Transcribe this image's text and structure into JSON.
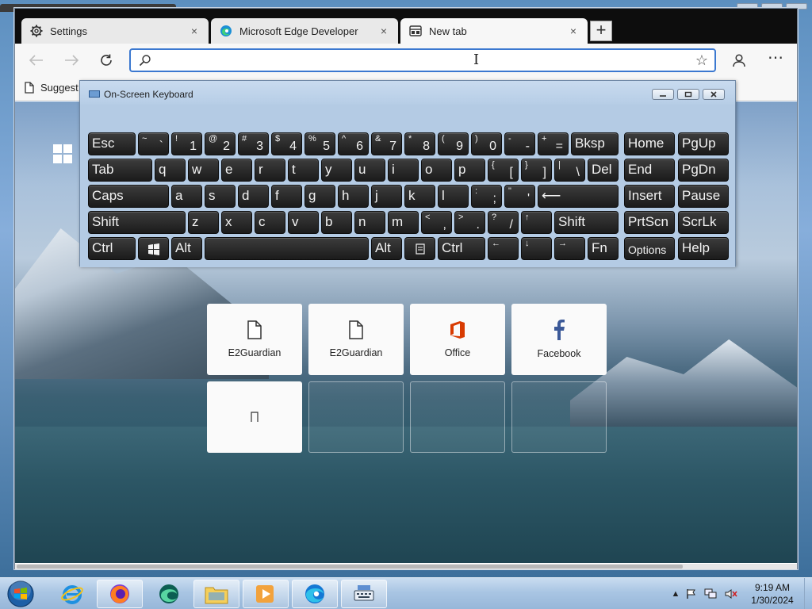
{
  "browser": {
    "tabs": [
      {
        "label": "Settings",
        "icon": "gear-icon",
        "close": "×"
      },
      {
        "label": "Microsoft Edge Developer",
        "icon": "edge-icon",
        "close": "×"
      },
      {
        "label": "New tab",
        "icon": "newtab-icon",
        "close": "×"
      }
    ],
    "new_tab_label": "+",
    "address_bar": {
      "value": "",
      "placeholder": ""
    },
    "favorites_bar": {
      "suggested_label": "Suggest"
    },
    "more_label": "⋯"
  },
  "osk": {
    "title": "On-Screen Keyboard",
    "keys": {
      "esc": "Esc",
      "bksp": "Bksp",
      "home": "Home",
      "pgup": "PgUp",
      "tab": "Tab",
      "del": "Del",
      "end": "End",
      "pgdn": "PgDn",
      "caps": "Caps",
      "insert": "Insert",
      "pause": "Pause",
      "shift": "Shift",
      "prtscn": "PrtScn",
      "scrlk": "ScrLk",
      "ctrl": "Ctrl",
      "alt": "Alt",
      "fn": "Fn",
      "options": "Options",
      "help": "Help",
      "enter_arrow": "⟵",
      "arrow_left": "←",
      "arrow_down": "↓",
      "arrow_right": "→",
      "arrow_up": "↑"
    },
    "row1_chars": [
      {
        "shift": "~",
        "base": "`"
      },
      {
        "shift": "!",
        "base": "1"
      },
      {
        "shift": "@",
        "base": "2"
      },
      {
        "shift": "#",
        "base": "3"
      },
      {
        "shift": "$",
        "base": "4"
      },
      {
        "shift": "%",
        "base": "5"
      },
      {
        "shift": "^",
        "base": "6"
      },
      {
        "shift": "&",
        "base": "7"
      },
      {
        "shift": "*",
        "base": "8"
      },
      {
        "shift": "(",
        "base": "9"
      },
      {
        "shift": ")",
        "base": "0"
      },
      {
        "shift": "-",
        "base": "-"
      },
      {
        "shift": "+",
        "base": "="
      }
    ],
    "row2_letters": [
      "q",
      "w",
      "e",
      "r",
      "t",
      "y",
      "u",
      "i",
      "o",
      "p"
    ],
    "row2_symbols": [
      {
        "shift": "{",
        "base": "["
      },
      {
        "shift": "}",
        "base": "]"
      },
      {
        "shift": "|",
        "base": "\\"
      }
    ],
    "row3_letters": [
      "a",
      "s",
      "d",
      "f",
      "g",
      "h",
      "j",
      "k",
      "l"
    ],
    "row3_symbols": [
      {
        "shift": ":",
        "base": ";"
      },
      {
        "shift": "\"",
        "base": "'"
      }
    ],
    "row4_letters": [
      "z",
      "x",
      "c",
      "v",
      "b",
      "n",
      "m"
    ],
    "row4_symbols": [
      {
        "shift": "<",
        "base": ","
      },
      {
        "shift": ">",
        "base": "."
      },
      {
        "shift": "?",
        "base": "/"
      }
    ]
  },
  "quick_links": [
    {
      "label": "E2Guardian",
      "icon": "page-icon"
    },
    {
      "label": "E2Guardian",
      "icon": "page-icon"
    },
    {
      "label": "Office",
      "icon": "office-icon",
      "color": "#D83B01"
    },
    {
      "label": "Facebook",
      "icon": "facebook-icon",
      "color": "#3B5998"
    },
    {
      "label": "",
      "icon": "placeholder-glyph-icon"
    }
  ],
  "taskbar": {
    "apps": [
      "ie-icon",
      "firefox-icon",
      "edge-dev-icon",
      "file-explorer-icon",
      "media-player-icon",
      "edge-icon",
      "on-screen-keyboard-icon"
    ],
    "clock": {
      "time": "9:19 AM",
      "date": "1/30/2024"
    }
  },
  "colors": {
    "accent": "#3B78D0",
    "tab_strip": "#0D0D0D",
    "osk_frame": "#B6CDE6",
    "office_red": "#D83B01",
    "facebook_blue": "#3B5998"
  }
}
